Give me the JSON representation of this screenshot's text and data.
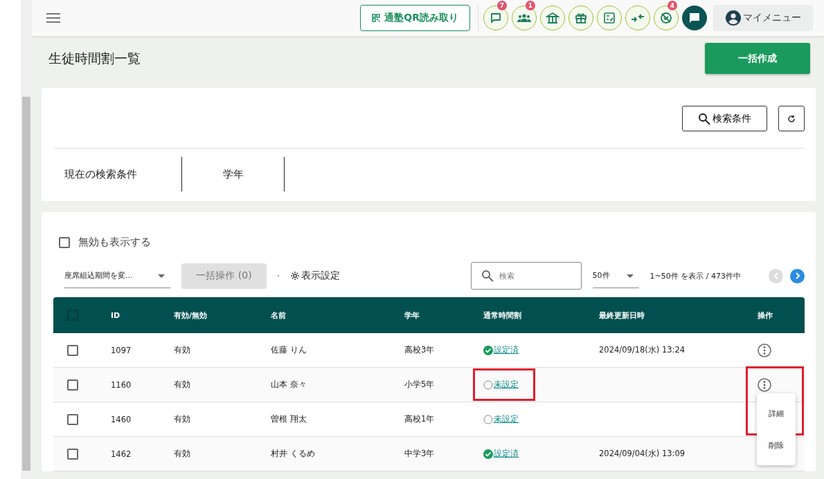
{
  "header": {
    "qr_button": "通塾QR読み取り",
    "icons": [
      {
        "kind": "chat",
        "badge": "7"
      },
      {
        "kind": "group",
        "badge": "1"
      },
      {
        "kind": "school"
      },
      {
        "kind": "gift"
      },
      {
        "kind": "checklist"
      },
      {
        "kind": "merge"
      },
      {
        "kind": "blocked",
        "badge": "4"
      },
      {
        "kind": "message-dark"
      }
    ],
    "my_menu": "マイメニュー"
  },
  "page": {
    "title": "生徒時間割一覧",
    "create_button": "一括作成"
  },
  "search_panel": {
    "search_button": "検索条件",
    "current_label": "現在の検索条件",
    "filters": [
      "学年"
    ]
  },
  "list": {
    "show_inactive": {
      "label": "無効も表示する",
      "checked": false
    },
    "period_select": "座席組込期間を変...",
    "bulk_button": {
      "label": "一括操作 (0)",
      "disabled": true
    },
    "display_settings": "表示設定",
    "search": {
      "placeholder": "検索"
    },
    "per_page": "50件",
    "range": "1~50件 を表示 / 473件中",
    "prev_disabled": true,
    "next_disabled": false,
    "columns": [
      "ID",
      "有効/無効",
      "名前",
      "学年",
      "通常時間割",
      "最終更新日時",
      "操作"
    ],
    "header_checked": false,
    "rows": [
      {
        "checked": false,
        "id": "1097",
        "status": "有効",
        "name": "佐藤 りん",
        "grade": "高校3年",
        "timetable": {
          "kind": "set",
          "label": "設定済"
        },
        "updated": "2024/09/18(水) 13:24",
        "highlighted": false,
        "menu_open": false
      },
      {
        "checked": false,
        "id": "1160",
        "status": "有効",
        "name": "山本 奈々",
        "grade": "小学5年",
        "timetable": {
          "kind": "unset",
          "label": "未設定"
        },
        "highlighted": true,
        "menu_open": true
      },
      {
        "checked": false,
        "id": "1460",
        "status": "有効",
        "name": "曽根 翔太",
        "grade": "高校1年",
        "timetable": {
          "kind": "unset",
          "label": "未設定"
        },
        "highlighted": false,
        "menu_open": false
      },
      {
        "checked": false,
        "id": "1462",
        "status": "有効",
        "name": "村井 くるめ",
        "grade": "中学3年",
        "timetable": {
          "kind": "set",
          "label": "設定済"
        },
        "updated": "2024/09/04(水) 13:09",
        "highlighted": false,
        "menu_open": false
      }
    ],
    "row_menu": [
      {
        "label": "詳細",
        "highlighted": true
      },
      {
        "label": "削除",
        "highlighted": false
      }
    ]
  }
}
